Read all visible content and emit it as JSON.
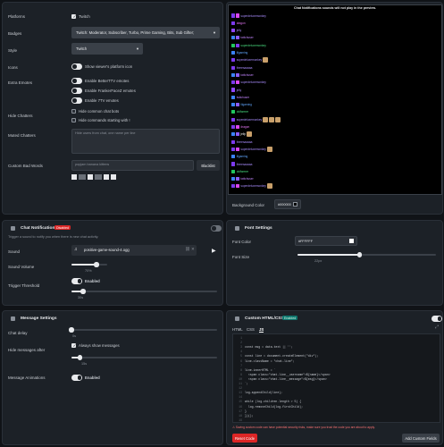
{
  "settings": {
    "platforms_label": "Platforms",
    "platform_twitch": "Twitch",
    "badges_label": "Badges",
    "badges_value": "Twitch: Moderator, Subscriber, Turbo, Prime Gaming, Bits, Sub Gifter;",
    "style_label": "Style",
    "style_value": "Twitch",
    "icons_label": "Icons",
    "icons_toggle": "Show viewer's platform icon",
    "extra_emotes_label": "Extra Emotes",
    "emote_bttv": "Enable BetterTTV emotes",
    "emote_ffz": "Enable FrankerFaceZ emotes",
    "emote_7tv": "Enable 7TV emotes",
    "hide_chatters_label": "Hide Chatters",
    "hide_bots": "Hide common chat bots",
    "hide_commands": "Hide commands starting with !",
    "muted_label": "Muted Chatters",
    "muted_placeholder": "Hide users from chat, one name per line",
    "bad_words_label": "Custom Bad Words",
    "bad_words_placeholder": "popjam banana kittens",
    "blacklist_button": "Blacklist"
  },
  "preview": {
    "title": "Chat Notifications sounds will not play in the preview.",
    "bg_label": "Background Color",
    "bg_value": "#000000",
    "rows": [
      {
        "name": "superdeluxemonkey",
        "color": "#a78bfa",
        "badges": [
          "#7c3aed",
          "#d946ef"
        ],
        "emotes": 0
      },
      {
        "name": "dragon",
        "color": "#e879f9",
        "badges": [
          "#7c3aed"
        ],
        "emotes": 0
      },
      {
        "name": "jelly",
        "color": "#a78bfa",
        "badges": [
          "#9146ff"
        ],
        "emotes": 0
      },
      {
        "name": "twitchuser",
        "color": "#c084fc",
        "badges": [
          "#3b82f6",
          "#8b5cf6"
        ],
        "emotes": 0
      },
      {
        "name": "superdeluxemonkey",
        "color": "#4ade80",
        "badges": [
          "#22c55e",
          "#7c3aed"
        ],
        "emotes": 0
      },
      {
        "name": "lilgaming",
        "color": "#60a5fa",
        "badges": [
          "#3b82f6"
        ],
        "emotes": 0
      },
      {
        "name": "superdeluxemonkey",
        "color": "#a78bfa",
        "badges": [
          "#7c3aed"
        ],
        "emotes": 1
      },
      {
        "name": "theresaaaaa",
        "color": "#a78bfa",
        "badges": [
          "#7c3aed"
        ],
        "emotes": 0
      },
      {
        "name": "twitchuser",
        "color": "#c084fc",
        "badges": [
          "#3b82f6",
          "#8b5cf6"
        ],
        "emotes": 0
      },
      {
        "name": "superdeluxemonkey",
        "color": "#a78bfa",
        "badges": [
          "#7c3aed",
          "#d946ef"
        ],
        "emotes": 0
      },
      {
        "name": "jelly",
        "color": "#a78bfa",
        "badges": [
          "#9146ff"
        ],
        "emotes": 0
      },
      {
        "name": "twitchuser",
        "color": "#c084fc",
        "badges": [
          "#3b82f6"
        ],
        "emotes": 0
      },
      {
        "name": "lilgaming",
        "color": "#60a5fa",
        "badges": [
          "#3b82f6",
          "#8b5cf6"
        ],
        "emotes": 0
      },
      {
        "name": "oldfarmer",
        "color": "#4ade80",
        "badges": [
          "#22c55e"
        ],
        "emotes": 0
      },
      {
        "name": "superdeluxemonkey",
        "color": "#a78bfa",
        "badges": [
          "#7c3aed"
        ],
        "emotes": 3
      },
      {
        "name": "dragon",
        "color": "#e879f9",
        "badges": [
          "#7c3aed",
          "#d946ef"
        ],
        "emotes": 0
      },
      {
        "name": "jelly",
        "color": "#ffffff",
        "badges": [
          "#3b82f6",
          "#8b5cf6"
        ],
        "emotes": 1
      },
      {
        "name": "theresaaaaa",
        "color": "#a78bfa",
        "badges": [
          "#7c3aed"
        ],
        "emotes": 0
      },
      {
        "name": "superdeluxemonkey",
        "color": "#a78bfa",
        "badges": [
          "#7c3aed",
          "#d946ef"
        ],
        "emotes": 1
      },
      {
        "name": "lilgaming",
        "color": "#60a5fa",
        "badges": [
          "#3b82f6"
        ],
        "emotes": 0
      },
      {
        "name": "theresaaaaa",
        "color": "#a78bfa",
        "badges": [
          "#7c3aed"
        ],
        "emotes": 0
      },
      {
        "name": "oldfarmer",
        "color": "#4ade80",
        "badges": [
          "#22c55e"
        ],
        "emotes": 0
      },
      {
        "name": "twitchuser",
        "color": "#c084fc",
        "badges": [
          "#3b82f6",
          "#8b5cf6"
        ],
        "emotes": 0
      },
      {
        "name": "superdeluxemonkey",
        "color": "#a78bfa",
        "badges": [
          "#7c3aed",
          "#d946ef"
        ],
        "emotes": 1
      }
    ]
  },
  "chat_notifications": {
    "title": "Chat Notifications",
    "badge": "Disabled",
    "desc": "Trigger a sound to notify you when there is new chat activity.",
    "sound_label": "Sound",
    "sound_file": "positive-game-sound-4.ogg",
    "volume_label": "Sound Volume",
    "volume_value": "70%",
    "volume_fraction": 0.7,
    "threshold_label": "Trigger Threshold",
    "threshold_toggle": "Enabled",
    "threshold_value": "30s",
    "threshold_fraction": 0.08
  },
  "font_settings": {
    "title": "Font Settings",
    "color_label": "Font Color",
    "color_value": "#FFFFFF",
    "size_label": "Font Size",
    "size_value": "22px",
    "size_fraction": 0.45
  },
  "message_settings": {
    "title": "Message Settings",
    "delay_label": "Chat delay",
    "delay_value": "0s",
    "delay_fraction": 0.0,
    "hide_label": "Hide messages after",
    "hide_always": "Always show messages",
    "hide_value": "15s",
    "hide_fraction": 0.06,
    "anim_label": "Message Animations",
    "anim_toggle": "Enabled"
  },
  "custom": {
    "title": "Custom HTML/CSS",
    "badge": "Enabled",
    "tabs": [
      "HTML",
      "CSS",
      "JS"
    ],
    "lines": [
      {
        "n": "1",
        "t": ""
      },
      {
        "n": "2",
        "t": ""
      },
      {
        "n": "3",
        "t": "const msg = data.text || '';"
      },
      {
        "n": "4",
        "t": ""
      },
      {
        "n": "5",
        "t": "const line = document.createElement(\"div\");"
      },
      {
        "n": "6",
        "t": "line.className = \"chat-line\";"
      },
      {
        "n": "7",
        "t": ""
      },
      {
        "n": "8",
        "t": "line.innerHTML = `"
      },
      {
        "n": "9",
        "t": "  <span class=\"chat-line__username\">${name}</span>"
      },
      {
        "n": "10",
        "t": "  <span class=\"chat-line__message\">${msg}</span>"
      },
      {
        "n": "11",
        "t": "`;"
      },
      {
        "n": "12",
        "t": ""
      },
      {
        "n": "13",
        "t": "log.appendChild(line);"
      },
      {
        "n": "14",
        "t": ""
      },
      {
        "n": "15",
        "t": "while (log.children.length > 5) {"
      },
      {
        "n": "16",
        "t": "  log.removeChild(log.firstChild);"
      },
      {
        "n": "17",
        "t": "}"
      },
      {
        "n": "18",
        "t": "})();"
      },
      {
        "n": "19",
        "t": ""
      }
    ],
    "warning": "Saving custom code can have potential security risks, make sure you trust the code you are about to apply.",
    "reset_button": "Reset Code",
    "add_fields_button": "Add Custom Fields"
  }
}
